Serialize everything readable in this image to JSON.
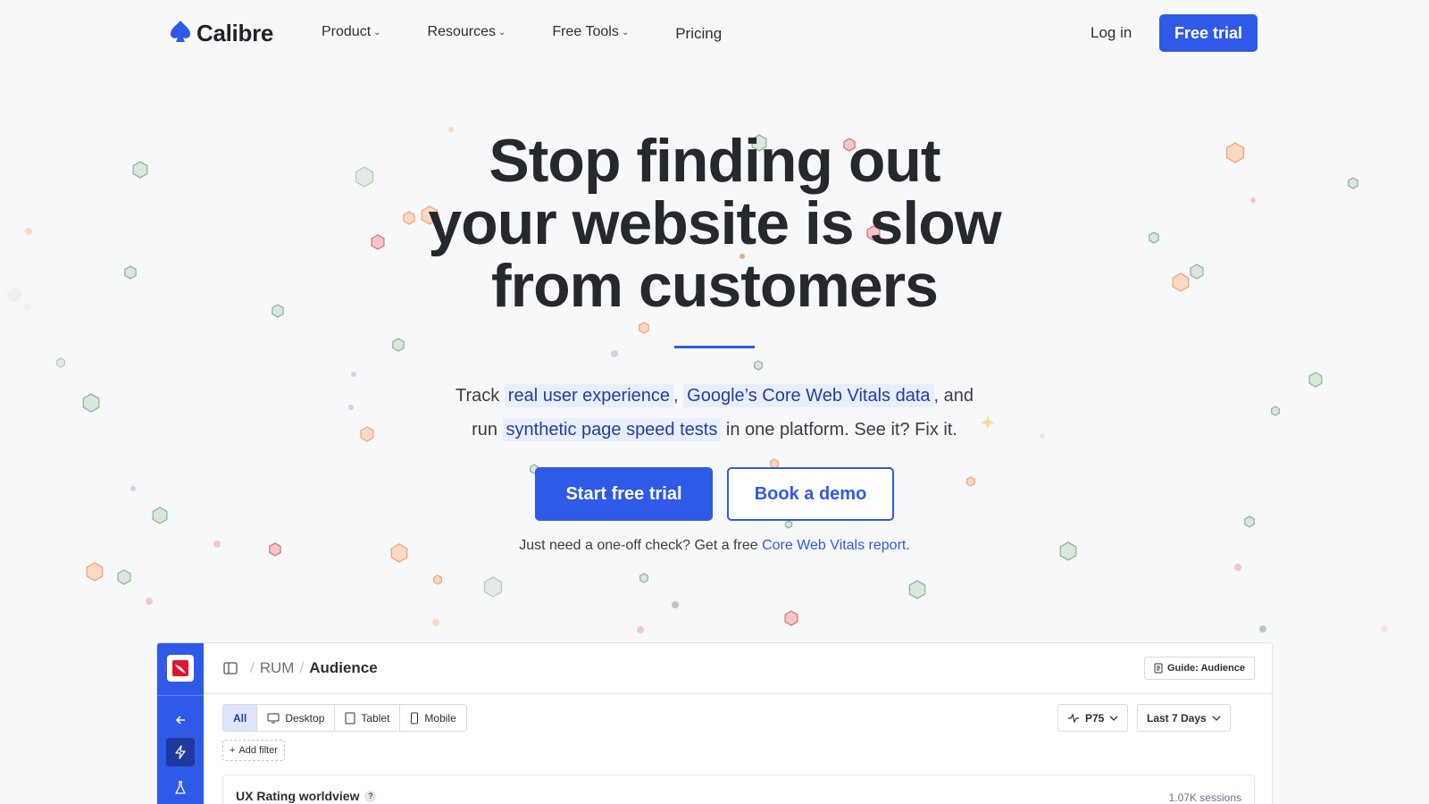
{
  "brand": {
    "name": "Calibre",
    "accent": "#2f5ae8"
  },
  "nav": {
    "items": [
      {
        "label": "Product",
        "has_dropdown": true
      },
      {
        "label": "Resources",
        "has_dropdown": true
      },
      {
        "label": "Free Tools",
        "has_dropdown": true
      },
      {
        "label": "Pricing",
        "has_dropdown": false
      }
    ],
    "login": "Log in",
    "free_trial": "Free trial"
  },
  "hero": {
    "title_line1": "Stop finding out",
    "title_line2": "your website is slow",
    "title_line3": "from customers",
    "sub": {
      "track": "Track",
      "link1": "real user experience",
      "comma": ",",
      "link2": "Google’s Core Web Vitals data",
      "and": ", and",
      "run": "run",
      "link3": "synthetic page speed tests",
      "tail": "in one platform. See it? Fix it."
    },
    "cta_primary": "Start free trial",
    "cta_secondary": "Book a demo",
    "oneoff_text": "Just need a one-off check? Get a free",
    "oneoff_link": "Core Web Vitals report",
    "oneoff_end": "."
  },
  "app": {
    "breadcrumb": [
      "RUM",
      "Audience"
    ],
    "guide": "Guide: Audience",
    "segments": [
      {
        "label": "All",
        "icon": "none",
        "active": true
      },
      {
        "label": "Desktop",
        "icon": "desktop-icon",
        "active": false
      },
      {
        "label": "Tablet",
        "icon": "tablet-icon",
        "active": false
      },
      {
        "label": "Mobile",
        "icon": "mobile-icon",
        "active": false
      }
    ],
    "add_filter": "Add filter",
    "percentile": "P75",
    "range": "Last 7 Days",
    "card_title": "UX Rating worldview",
    "card_help": "?",
    "sessions": "1.07K sessions"
  }
}
